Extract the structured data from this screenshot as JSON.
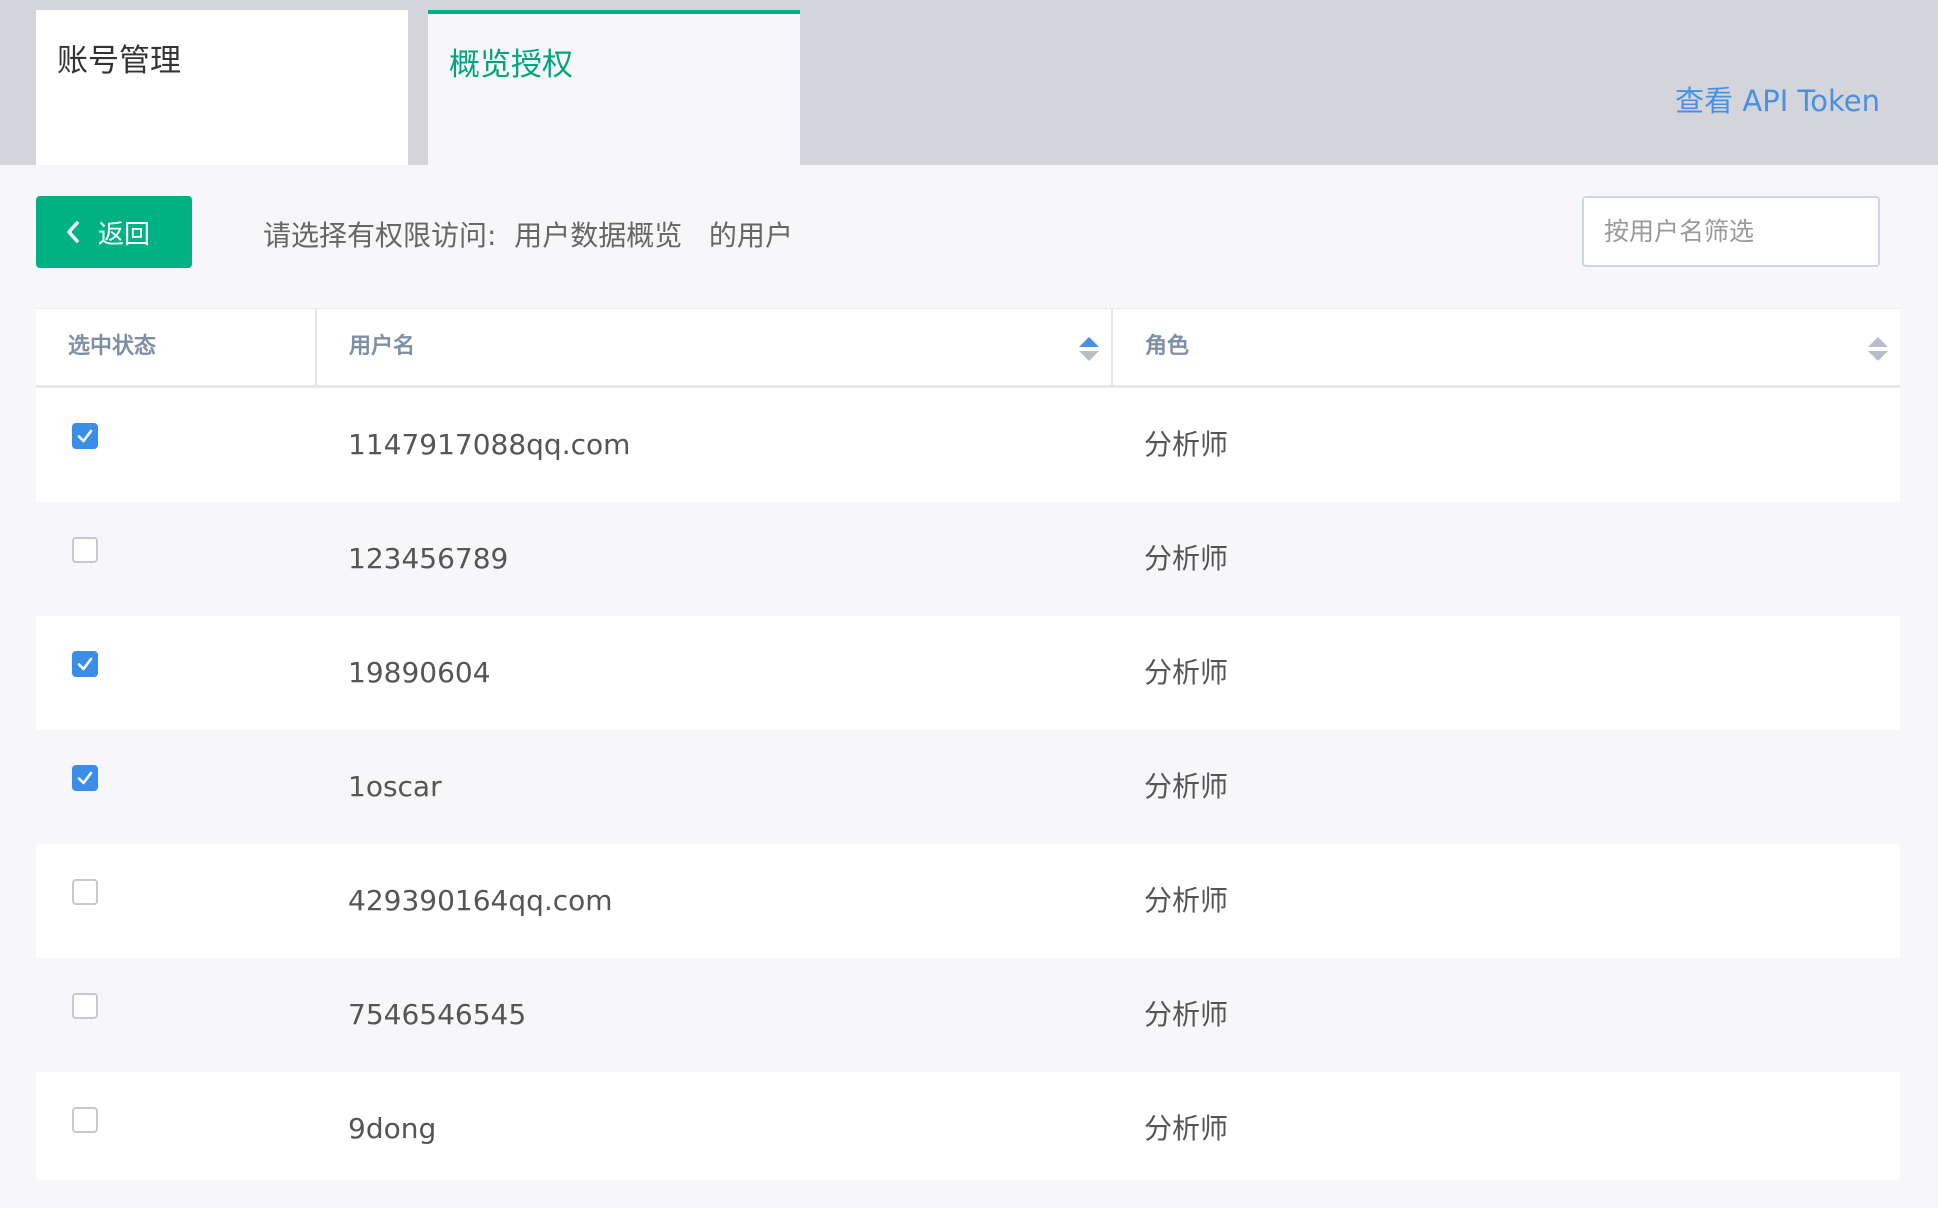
{
  "tabs": {
    "account": "账号管理",
    "overview": "概览授权"
  },
  "api_token_link": "查看 API Token",
  "back_button": "返回",
  "prompt": "请选择有权限访问:  用户数据概览   的用户",
  "filter": {
    "placeholder": "按用户名筛选",
    "value": ""
  },
  "table": {
    "headers": {
      "status": "选中状态",
      "username": "用户名",
      "role": "角色"
    },
    "rows": [
      {
        "checked": true,
        "username": "1147917088qq.com",
        "role": "分析师"
      },
      {
        "checked": false,
        "username": "123456789",
        "role": "分析师"
      },
      {
        "checked": true,
        "username": "19890604",
        "role": "分析师"
      },
      {
        "checked": true,
        "username": "1oscar",
        "role": "分析师"
      },
      {
        "checked": false,
        "username": "429390164qq.com",
        "role": "分析师"
      },
      {
        "checked": false,
        "username": "7546546545",
        "role": "分析师"
      },
      {
        "checked": false,
        "username": "9dong",
        "role": "分析师"
      }
    ]
  },
  "colors": {
    "accent_green": "#00b183",
    "link_blue": "#4a90e2",
    "checkbox_blue": "#3a8ee6",
    "sort_active": "#4a90e2",
    "sort_inactive": "#b8bec8"
  },
  "icons": {
    "back": "chevron-left-icon",
    "sort": "sort-icon",
    "check": "checkmark-icon"
  }
}
